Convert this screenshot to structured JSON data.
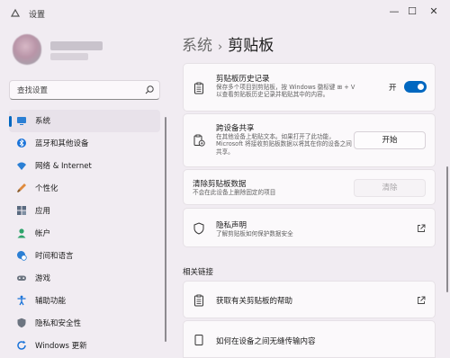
{
  "window": {
    "title": "设置",
    "controls": {
      "minimize": "—",
      "maximize": "☐",
      "close": "✕"
    }
  },
  "search": {
    "placeholder": "查找设置"
  },
  "sidebar": {
    "items": [
      {
        "label": "系统",
        "icon": "monitor-icon",
        "selected": true
      },
      {
        "label": "蓝牙和其他设备",
        "icon": "bluetooth-icon"
      },
      {
        "label": "网络 & Internet",
        "icon": "wifi-icon"
      },
      {
        "label": "个性化",
        "icon": "brush-icon"
      },
      {
        "label": "应用",
        "icon": "apps-icon"
      },
      {
        "label": "帐户",
        "icon": "person-icon"
      },
      {
        "label": "时间和语言",
        "icon": "globe-clock-icon"
      },
      {
        "label": "游戏",
        "icon": "gamepad-icon"
      },
      {
        "label": "辅助功能",
        "icon": "accessibility-icon"
      },
      {
        "label": "隐私和安全性",
        "icon": "shield-icon"
      },
      {
        "label": "Windows 更新",
        "icon": "update-icon"
      }
    ]
  },
  "breadcrumb": {
    "parent": "系统",
    "separator": "›",
    "current": "剪贴板"
  },
  "cards": {
    "history": {
      "title": "剪贴板历史记录",
      "desc": "保存多个项目到剪贴板，按 Windows 徽标键 ⊞ + V 以查看剪贴板历史记录并粘贴其中的内容。",
      "toggle_label": "开",
      "toggle_on": true
    },
    "sync": {
      "title": "跨设备共享",
      "desc": "在其他设备上粘贴文本。如果打开了此功能，Microsoft 将接收剪贴板数据以将其在你的设备之间共享。",
      "button": "开始"
    },
    "clear": {
      "title": "清除剪贴板数据",
      "desc": "不会在此设备上删除固定的项目",
      "button": "清除"
    },
    "privacy": {
      "title": "隐私声明",
      "desc": "了解剪贴板如何保护数据安全"
    }
  },
  "related": {
    "heading": "相关链接",
    "links": [
      {
        "label": "获取有关剪贴板的帮助"
      },
      {
        "label": "如何在设备之间无缝传输内容"
      }
    ]
  },
  "colors": {
    "accent": "#0067c0",
    "background": "#f1ecf2",
    "card": "#fbf9fb"
  }
}
